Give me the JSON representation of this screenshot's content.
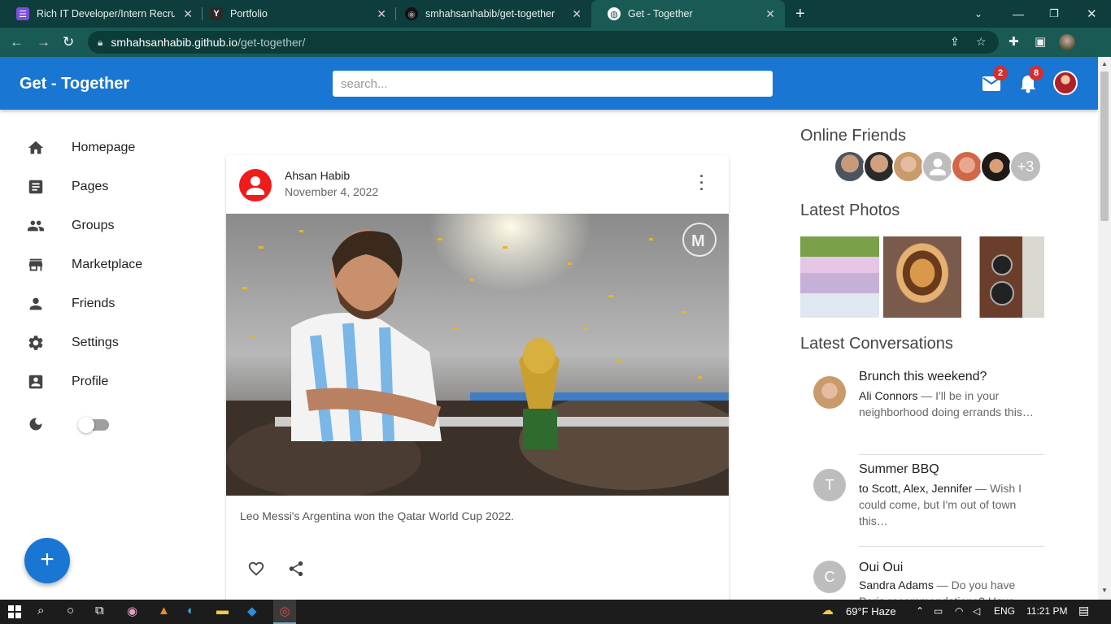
{
  "browser": {
    "tabs": [
      {
        "title": "Rich IT Developer/Intern Recruitm",
        "fav_text": "☰",
        "fav_color": "#7b4fd8"
      },
      {
        "title": "Portfolio",
        "fav_text": "Y",
        "fav_color": "#2a2a2a"
      },
      {
        "title": "smhahsanhabib/get-together",
        "fav_text": "◉",
        "fav_color": "#111111"
      },
      {
        "title": "Get - Together",
        "fav_text": "◍",
        "fav_color": "#1a5a55"
      }
    ],
    "new_tab_label": "+",
    "url_host": "smhahsanhabib.github.io",
    "url_path": "/get-together/"
  },
  "app": {
    "brand": "Get - Together",
    "search_placeholder": "search...",
    "mail_count": "2",
    "notif_count": "8",
    "accent_color": "#1976d2"
  },
  "sidebar": {
    "items": [
      {
        "label": "Homepage",
        "icon": "home-icon"
      },
      {
        "label": "Pages",
        "icon": "article-icon"
      },
      {
        "label": "Groups",
        "icon": "group-icon"
      },
      {
        "label": "Marketplace",
        "icon": "storefront-icon"
      },
      {
        "label": "Friends",
        "icon": "person-icon"
      },
      {
        "label": "Settings",
        "icon": "gear-icon"
      },
      {
        "label": "Profile",
        "icon": "account-box-icon"
      }
    ],
    "fab_label": "+"
  },
  "post": {
    "author": "Ahsan Habib",
    "date": "November 4, 2022",
    "caption": "Leo Messi's Argentina won the Qatar World Cup 2022."
  },
  "right": {
    "online_title": "Online Friends",
    "online_more": "+3",
    "photos_title": "Latest Photos",
    "conversations_title": "Latest Conversations",
    "conversations": [
      {
        "title": "Brunch this weekend?",
        "sender": "Ali Connors",
        "text": " — I'll be in your neighborhood doing errands this…",
        "initial": ""
      },
      {
        "title": "Summer BBQ",
        "sender": "to Scott, Alex, Jennifer",
        "text": " — Wish I could come, but I'm out of town this…",
        "initial": "T"
      },
      {
        "title": "Oui Oui",
        "sender": "Sandra Adams",
        "text": " — Do you have Paris recommendations? Have…",
        "initial": "C"
      }
    ]
  },
  "taskbar": {
    "weather": "69°F  Haze",
    "lang": "ENG",
    "time": "11:21 PM"
  }
}
